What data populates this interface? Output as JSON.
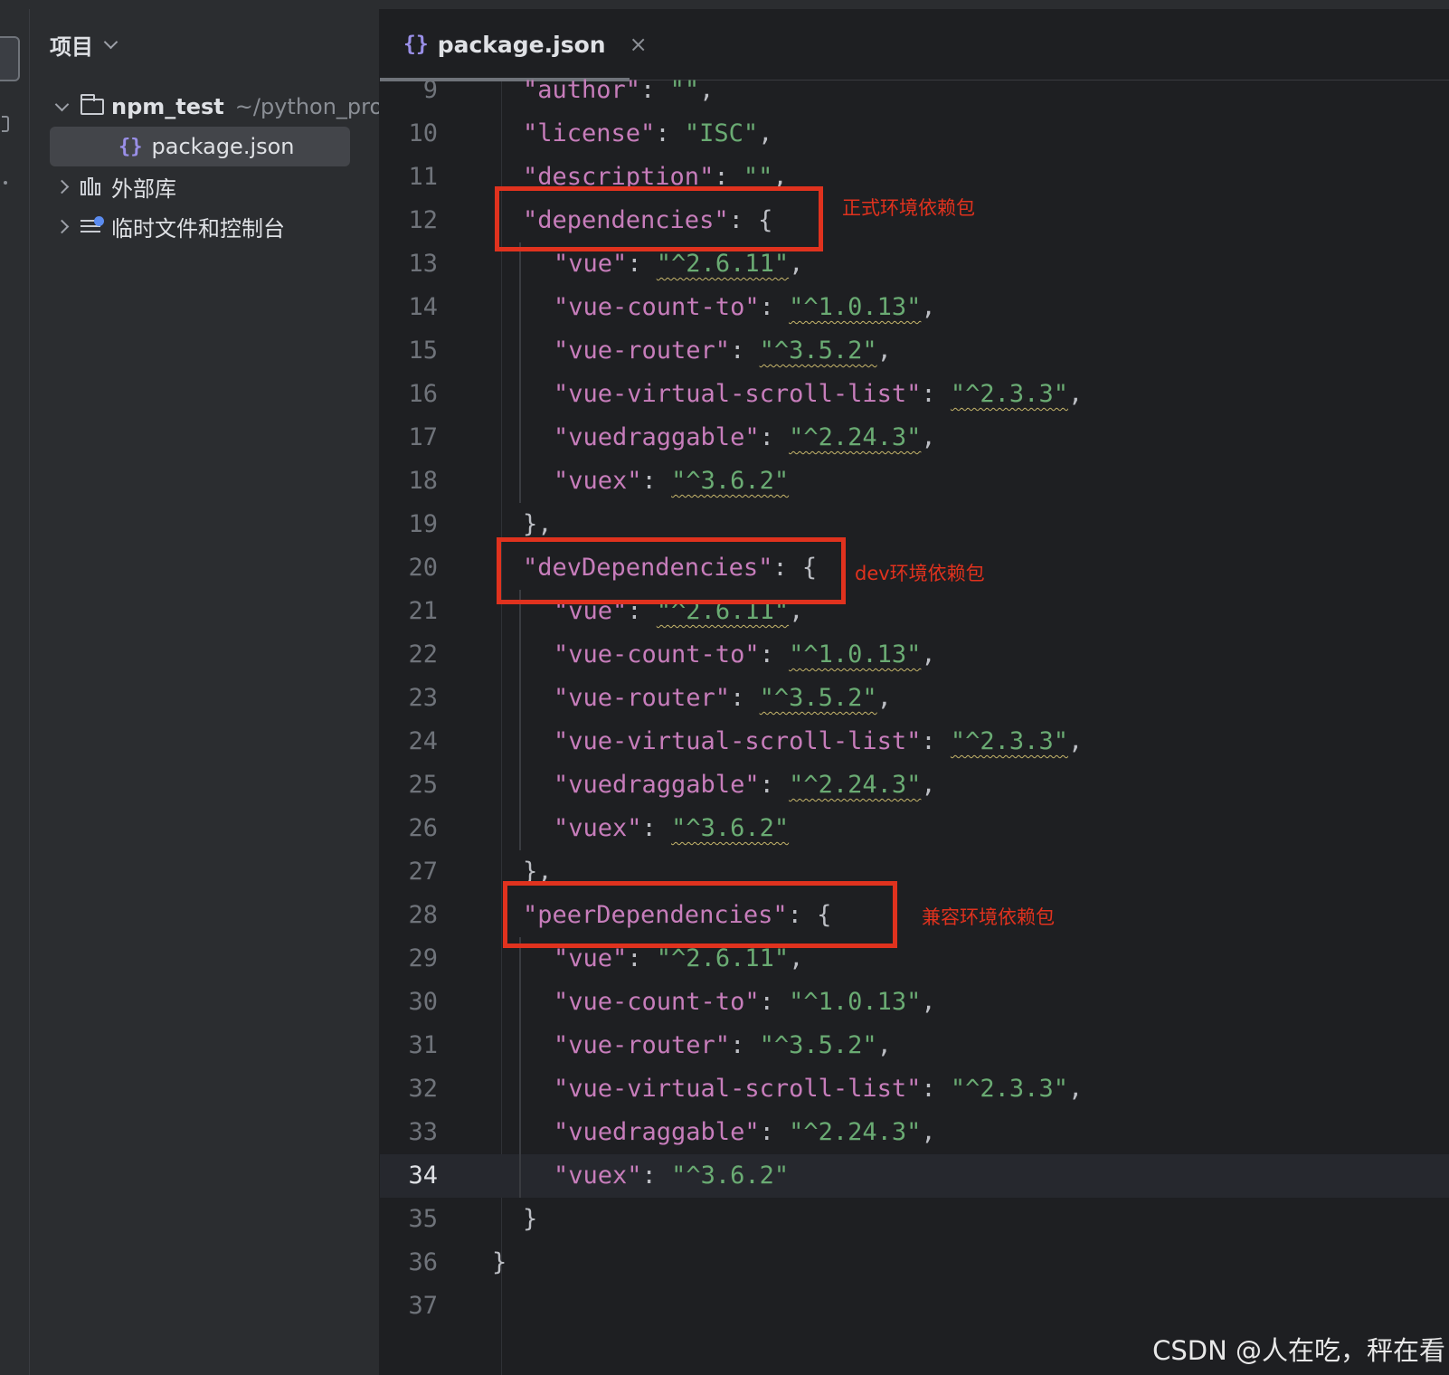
{
  "project_panel": {
    "title": "项目",
    "root": {
      "name": "npm_test",
      "path": "~/python_pro/"
    },
    "file": "package.json",
    "external_libs": "外部库",
    "scratches": "临时文件和控制台"
  },
  "editor": {
    "tab": {
      "label": "package.json",
      "close": "×"
    },
    "current_line": "34",
    "lines": [
      {
        "n": "9",
        "key": "author",
        "val": "\"\"",
        "tail": ","
      },
      {
        "n": "10",
        "key": "license",
        "val": "\"ISC\"",
        "tail": ","
      },
      {
        "n": "11",
        "key": "description",
        "val": "\"\"",
        "tail": ","
      },
      {
        "n": "12",
        "key": "dependencies",
        "open": "{"
      },
      {
        "n": "13",
        "key": "vue",
        "val": "\"^2.6.11\"",
        "tail": ","
      },
      {
        "n": "14",
        "key": "vue-count-to",
        "val": "\"^1.0.13\"",
        "tail": ","
      },
      {
        "n": "15",
        "key": "vue-router",
        "val": "\"^3.5.2\"",
        "tail": ","
      },
      {
        "n": "16",
        "key": "vue-virtual-scroll-list",
        "val": "\"^2.3.3\"",
        "tail": ","
      },
      {
        "n": "17",
        "key": "vuedraggable",
        "val": "\"^2.24.3\"",
        "tail": ","
      },
      {
        "n": "18",
        "key": "vuex",
        "val": "\"^3.6.2\"",
        "tail": ""
      },
      {
        "n": "19",
        "text": "},"
      },
      {
        "n": "20",
        "key": "devDependencies",
        "open": "{"
      },
      {
        "n": "21",
        "key": "vue",
        "val": "\"^2.6.11\"",
        "tail": ","
      },
      {
        "n": "22",
        "key": "vue-count-to",
        "val": "\"^1.0.13\"",
        "tail": ","
      },
      {
        "n": "23",
        "key": "vue-router",
        "val": "\"^3.5.2\"",
        "tail": ","
      },
      {
        "n": "24",
        "key": "vue-virtual-scroll-list",
        "val": "\"^2.3.3\"",
        "tail": ","
      },
      {
        "n": "25",
        "key": "vuedraggable",
        "val": "\"^2.24.3\"",
        "tail": ","
      },
      {
        "n": "26",
        "key": "vuex",
        "val": "\"^3.6.2\"",
        "tail": ""
      },
      {
        "n": "27",
        "text": "},"
      },
      {
        "n": "28",
        "key": "peerDependencies",
        "open": "{"
      },
      {
        "n": "29",
        "key": "vue",
        "val": "\"^2.6.11\"",
        "tail": ","
      },
      {
        "n": "30",
        "key": "vue-count-to",
        "val": "\"^1.0.13\"",
        "tail": ","
      },
      {
        "n": "31",
        "key": "vue-router",
        "val": "\"^3.5.2\"",
        "tail": ","
      },
      {
        "n": "32",
        "key": "vue-virtual-scroll-list",
        "val": "\"^2.3.3\"",
        "tail": ","
      },
      {
        "n": "33",
        "key": "vuedraggable",
        "val": "\"^2.24.3\"",
        "tail": ","
      },
      {
        "n": "34",
        "key": "vuex",
        "val": "\"^3.6.2\"",
        "tail": ""
      },
      {
        "n": "35",
        "text": "}"
      },
      {
        "n": "36",
        "text": "}"
      },
      {
        "n": "37",
        "text": ""
      }
    ]
  },
  "annotations": {
    "dependencies": "正式环境依赖包",
    "devDependencies": "dev环境依赖包",
    "peerDependencies": "兼容环境依赖包"
  },
  "watermark": "CSDN @人在吃，秤在看",
  "colors": {
    "annotation_red": "#e0321e",
    "key_purple": "#c77dbb",
    "string_green": "#6aab73"
  }
}
